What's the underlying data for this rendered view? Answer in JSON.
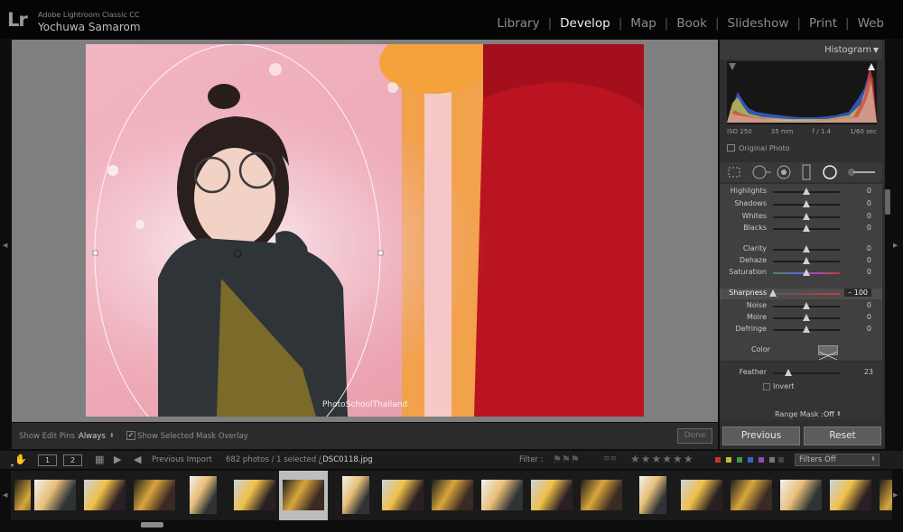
{
  "app": {
    "logo": "Lr",
    "product_name": "Adobe Lightroom Classic CC",
    "user_name": "Yochuwa Samarom"
  },
  "modules": [
    {
      "label": "Library",
      "active": false
    },
    {
      "label": "Develop",
      "active": true
    },
    {
      "label": "Map",
      "active": false
    },
    {
      "label": "Book",
      "active": false
    },
    {
      "label": "Slideshow",
      "active": false
    },
    {
      "label": "Print",
      "active": false
    },
    {
      "label": "Web",
      "active": false
    }
  ],
  "photo": {
    "watermark": "PhotoSchoolThailand"
  },
  "toolbar": {
    "edit_pins_label": "Show Edit Pins :",
    "edit_pins_value": "Always",
    "mask_overlay_label": "Show Selected Mask Overlay",
    "mask_overlay_checked": true,
    "done_label": "Done"
  },
  "histogram": {
    "title": "Histogram",
    "iso": "ISO 250",
    "focal": "35 mm",
    "aperture": "f / 1.4",
    "shutter": "1/60 sec",
    "original_photo_label": "Original Photo"
  },
  "sliders": [
    {
      "label": "Highlights",
      "value": "0",
      "pos": 0.5
    },
    {
      "label": "Shadows",
      "value": "0",
      "pos": 0.5
    },
    {
      "label": "Whites",
      "value": "0",
      "pos": 0.5
    },
    {
      "label": "Blacks",
      "value": "0",
      "pos": 0.5
    },
    {
      "label": "Clarity",
      "value": "0",
      "pos": 0.5
    },
    {
      "label": "Dehaze",
      "value": "0",
      "pos": 0.5
    },
    {
      "label": "Saturation",
      "value": "0",
      "pos": 0.5
    },
    {
      "label": "Sharpness",
      "value": "– 100",
      "pos": 0.0,
      "highlight": true
    },
    {
      "label": "Noise",
      "value": "0",
      "pos": 0.5
    },
    {
      "label": "Moire",
      "value": "0",
      "pos": 0.5
    },
    {
      "label": "Defringe",
      "value": "0",
      "pos": 0.5
    }
  ],
  "mask": {
    "color_label": "Color",
    "feather_label": "Feather",
    "feather_value": "23",
    "feather_pos": 0.23,
    "invert_label": "Invert",
    "range_mask_label": "Range Mask :",
    "range_mask_value": "Off"
  },
  "buttons": {
    "previous": "Previous",
    "reset": "Reset"
  },
  "filmstrip": {
    "page1": "1",
    "page2": "2",
    "source": "Previous Import",
    "count": "682 photos / 1 selected /",
    "filename": "_DSC0118.jpg",
    "filter_label": "Filter :",
    "filters_off": "Filters Off"
  },
  "colors": {
    "accent_text": "#f0f0f0",
    "panel_bg": "#404040",
    "mask_red": "#c41e2a"
  },
  "icons": [
    "hand-icon",
    "grid-view-icon",
    "back-arrow-icon",
    "forward-arrow-icon",
    "star-icon",
    "flag-icon",
    "histogram-clip-icon",
    "crop-overlay-icon",
    "spot-removal-icon",
    "red-eye-icon",
    "graduated-filter-icon",
    "radial-filter-icon",
    "adjustment-brush-icon"
  ]
}
